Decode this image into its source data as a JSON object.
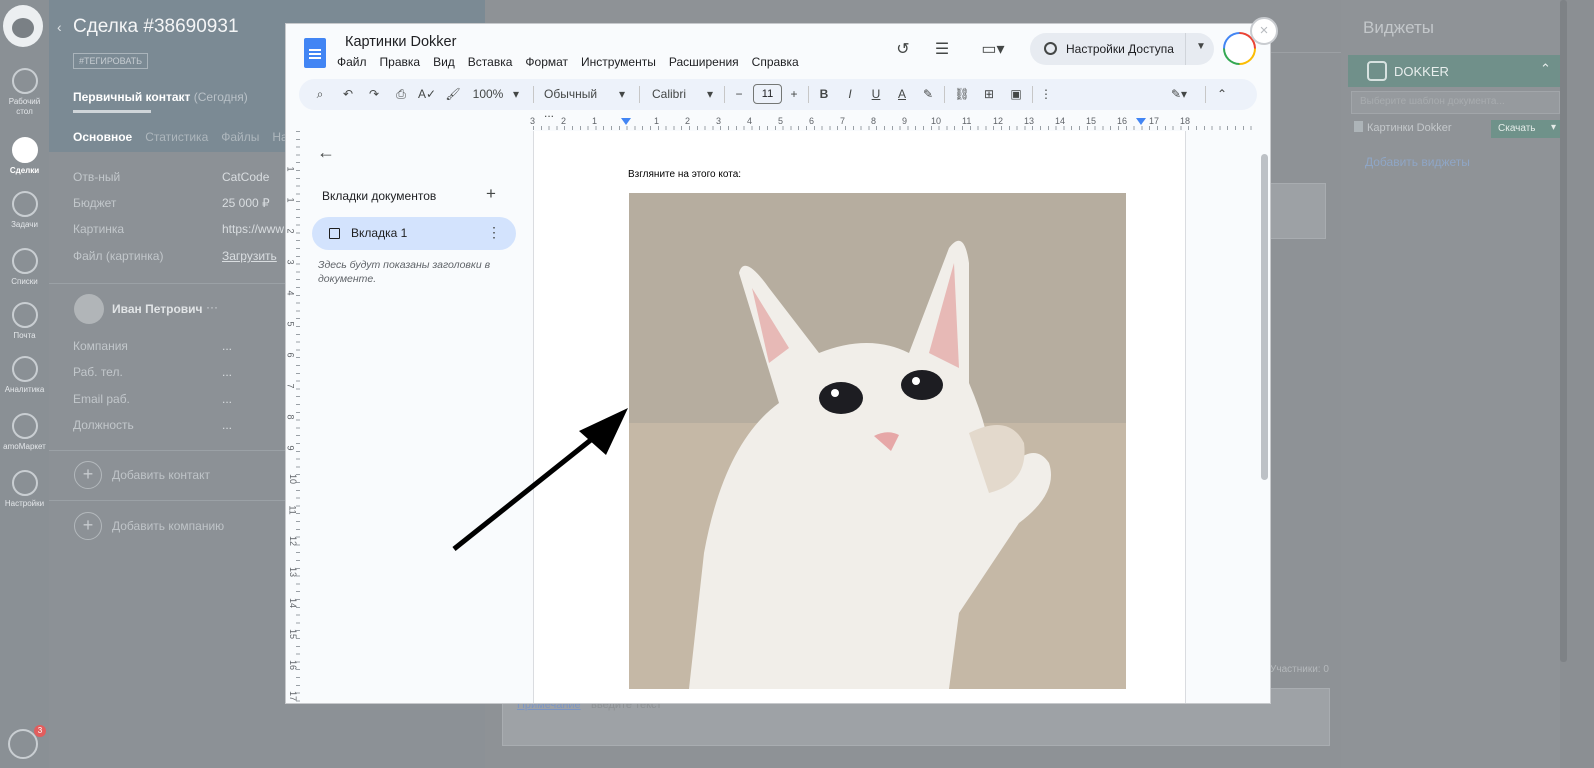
{
  "crm": {
    "nav": [
      {
        "label": "Рабочий стол",
        "icon": "dashboard-icon"
      },
      {
        "label": "Сделки",
        "icon": "deals-icon",
        "active": true
      },
      {
        "label": "Задачи",
        "icon": "tasks-icon"
      },
      {
        "label": "Списки",
        "icon": "lists-icon"
      },
      {
        "label": "Почта",
        "icon": "mail-icon"
      },
      {
        "label": "Аналитика",
        "icon": "analytics-icon"
      },
      {
        "label": "amoМаркет",
        "icon": "market-icon"
      },
      {
        "label": "Настройки",
        "icon": "settings-icon"
      }
    ],
    "chat_badge": "3",
    "deal": {
      "title": "Сделка #38690931",
      "tag_button": "#ТЕГИРОВАТЬ",
      "status": "Первичный контакт",
      "status_date": "(Сегодня)",
      "tabs": [
        "Основное",
        "Статистика",
        "Файлы",
        "Нас"
      ],
      "fields": [
        {
          "label": "Отв-ный",
          "value": "CatCode"
        },
        {
          "label": "Бюджет",
          "value": "25 000 ₽"
        },
        {
          "label": "Картинка",
          "value": "https://www"
        },
        {
          "label": "Файл (картинка)",
          "value": "Загрузить"
        }
      ],
      "contact_name": "Иван Петрович",
      "contact_more": "···",
      "contact_fields": [
        {
          "label": "Компания",
          "value": "..."
        },
        {
          "label": "Раб. тел.",
          "value": "..."
        },
        {
          "label": "Email раб.",
          "value": "..."
        },
        {
          "label": "Должность",
          "value": "..."
        }
      ],
      "add_contact": "Добавить контакт",
      "add_company": "Добавить компанию"
    },
    "note_link": "Примечание",
    "note_placeholder": "введите текст",
    "participants": "Участники: 0"
  },
  "widgets": {
    "title": "Виджеты",
    "dokker": {
      "name": "DOKKER",
      "select_placeholder": "Выберите шаблон документа...",
      "file_name": "Картинки Dokker",
      "download_label": "Скачать"
    },
    "add_widgets": "Добавить виджеты"
  },
  "gdoc": {
    "title": "Картинки Dokker",
    "menu": [
      "Файл",
      "Правка",
      "Вид",
      "Вставка",
      "Формат",
      "Инструменты",
      "Расширения",
      "Справка"
    ],
    "share_label": "Настройки Доступа",
    "toolbar": {
      "zoom": "100%",
      "style": "Обычный ...",
      "font": "Calibri",
      "font_size": "11"
    },
    "ruler_numbers": [
      "3",
      "2",
      "1",
      "1",
      "2",
      "3",
      "4",
      "5",
      "6",
      "7",
      "8",
      "9",
      "10",
      "11",
      "12",
      "13",
      "14",
      "15",
      "16",
      "17",
      "18"
    ],
    "vruler_numbers": [
      "1",
      "1",
      "2",
      "3",
      "4",
      "5",
      "6",
      "7",
      "8",
      "9",
      "10",
      "11",
      "12",
      "13",
      "14",
      "15",
      "16",
      "17"
    ],
    "tabs_heading": "Вкладки документов",
    "tab_label": "Вкладка 1",
    "tabs_hint": "Здесь будут показаны заголовки в документе.",
    "page_text": "Взгляните на этого кота:",
    "accent": "#d3e3fd"
  }
}
